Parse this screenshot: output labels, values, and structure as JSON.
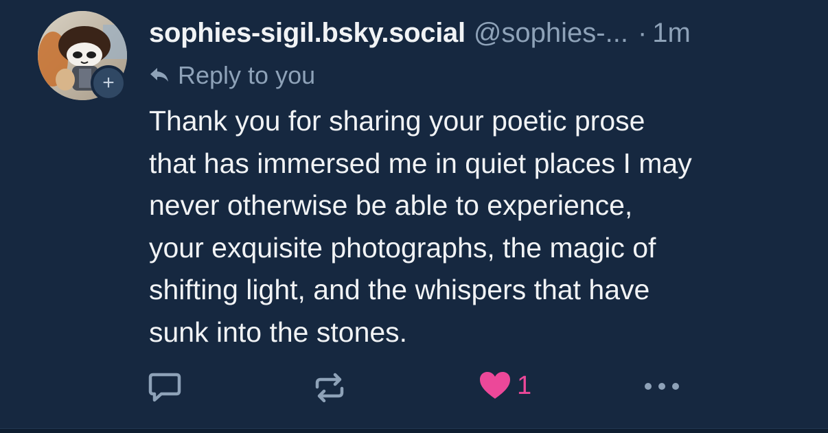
{
  "post": {
    "author": {
      "display_name": "sophies-sigil.bsky.social",
      "handle": "@sophies-...",
      "avatar_icon": "avatar-photo",
      "follow_icon": "plus-icon",
      "follow_symbol": "+"
    },
    "separator": "·",
    "timestamp": "1m",
    "reply_to": {
      "icon": "reply-arrow-icon",
      "label": "Reply to you"
    },
    "text_lines": [
      "Thank you for sharing your poetic prose",
      "that has immersed me in quiet places I may",
      "never otherwise be able to experience,",
      "your exquisite photographs, the magic of",
      "shifting light, and the whispers that have",
      "sunk into the stones."
    ],
    "actions": {
      "reply_icon": "comment-icon",
      "repost_icon": "repost-icon",
      "like_icon": "heart-icon",
      "like_count": "1",
      "like_active": true,
      "more_icon": "more-dots-icon"
    }
  },
  "colors": {
    "background": "#162840",
    "text_primary": "#f1f3f5",
    "text_secondary": "#8ea2b8",
    "like_pink": "#ec4899"
  }
}
